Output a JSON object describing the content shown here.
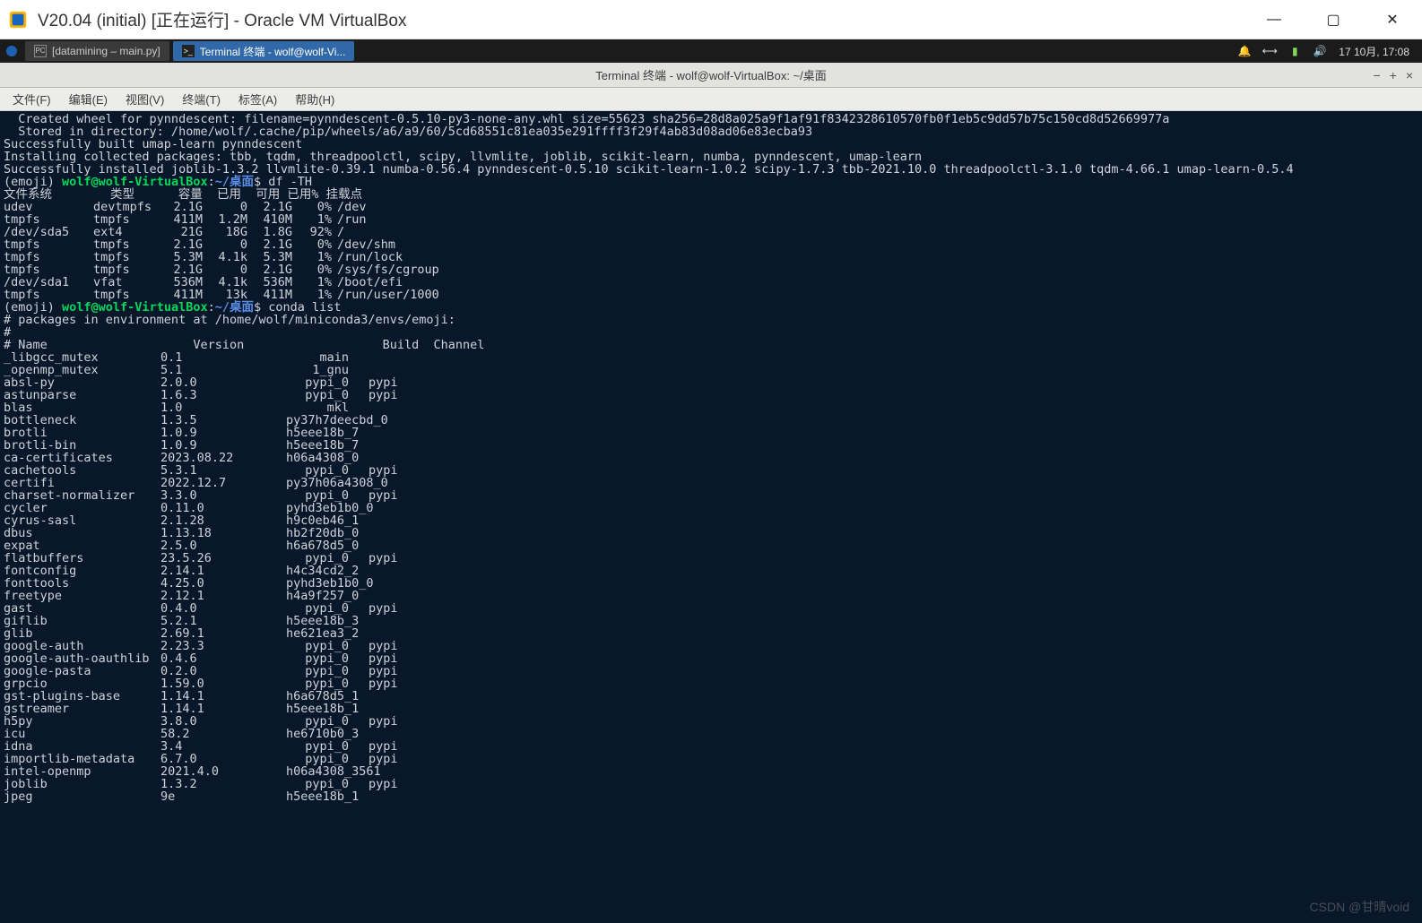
{
  "window": {
    "title": "V20.04 (initial) [正在运行] - Oracle VM VirtualBox",
    "min": "—",
    "max": "▢",
    "close": "✕"
  },
  "panel": {
    "task_inactive": "[datamining – main.py]",
    "task_active": "Terminal 终端 - wolf@wolf-Vi...",
    "clock": "17 10月, 17:08"
  },
  "gterm": {
    "title": "Terminal 终端 - wolf@wolf-VirtualBox: ~/桌面",
    "min": "−",
    "max": "+",
    "close": "×"
  },
  "menubar": {
    "file": "文件(F)",
    "edit": "编辑(E)",
    "view": "视图(V)",
    "terminal": "终端(T)",
    "tabs": "标签(A)",
    "help": "帮助(H)"
  },
  "term": {
    "build_lines": [
      "  Created wheel for pynndescent: filename=pynndescent-0.5.10-py3-none-any.whl size=55623 sha256=28d8a025a9f1af91f8342328610570fb0f1eb5c9dd57b75c150cd8d52669977a",
      "  Stored in directory: /home/wolf/.cache/pip/wheels/a6/a9/60/5cd68551c81ea035e291ffff3f29f4ab83d08ad06e83ecba93",
      "Successfully built umap-learn pynndescent",
      "Installing collected packages: tbb, tqdm, threadpoolctl, scipy, llvmlite, joblib, scikit-learn, numba, pynndescent, umap-learn",
      "Successfully installed joblib-1.3.2 llvmlite-0.39.1 numba-0.56.4 pynndescent-0.5.10 scikit-learn-1.0.2 scipy-1.7.3 tbb-2021.10.0 threadpoolctl-3.1.0 tqdm-4.66.1 umap-learn-0.5.4"
    ],
    "prompt_env": "(emoji) ",
    "prompt_userhost": "wolf@wolf-VirtualBox",
    "prompt_colon": ":",
    "prompt_path": "~/桌面",
    "prompt_dollar": "$ ",
    "cmd_df": "df -TH",
    "cmd_conda": "conda list",
    "df_header": "文件系统        类型      容量  已用  可用 已用% 挂载点",
    "df_rows": [
      {
        "fs": "udev",
        "type": "devtmpfs",
        "size": "2.1G",
        "used": "0",
        "avail": "2.1G",
        "pct": "0%",
        "mnt": "/dev"
      },
      {
        "fs": "tmpfs",
        "type": "tmpfs",
        "size": "411M",
        "used": "1.2M",
        "avail": "410M",
        "pct": "1%",
        "mnt": "/run"
      },
      {
        "fs": "/dev/sda5",
        "type": "ext4",
        "size": "21G",
        "used": "18G",
        "avail": "1.8G",
        "pct": "92%",
        "mnt": "/"
      },
      {
        "fs": "tmpfs",
        "type": "tmpfs",
        "size": "2.1G",
        "used": "0",
        "avail": "2.1G",
        "pct": "0%",
        "mnt": "/dev/shm"
      },
      {
        "fs": "tmpfs",
        "type": "tmpfs",
        "size": "5.3M",
        "used": "4.1k",
        "avail": "5.3M",
        "pct": "1%",
        "mnt": "/run/lock"
      },
      {
        "fs": "tmpfs",
        "type": "tmpfs",
        "size": "2.1G",
        "used": "0",
        "avail": "2.1G",
        "pct": "0%",
        "mnt": "/sys/fs/cgroup"
      },
      {
        "fs": "/dev/sda1",
        "type": "vfat",
        "size": "536M",
        "used": "4.1k",
        "avail": "536M",
        "pct": "1%",
        "mnt": "/boot/efi"
      },
      {
        "fs": "tmpfs",
        "type": "tmpfs",
        "size": "411M",
        "used": "13k",
        "avail": "411M",
        "pct": "1%",
        "mnt": "/run/user/1000"
      }
    ],
    "conda_header1": "# packages in environment at /home/wolf/miniconda3/envs/emoji:",
    "conda_header2": "#",
    "conda_header3": "# Name                    Version                   Build  Channel",
    "packages": [
      {
        "name": "_libgcc_mutex",
        "ver": "0.1",
        "build": "main",
        "ch": ""
      },
      {
        "name": "_openmp_mutex",
        "ver": "5.1",
        "build": "1_gnu",
        "ch": ""
      },
      {
        "name": "absl-py",
        "ver": "2.0.0",
        "build": "pypi_0",
        "ch": "pypi"
      },
      {
        "name": "astunparse",
        "ver": "1.6.3",
        "build": "pypi_0",
        "ch": "pypi"
      },
      {
        "name": "blas",
        "ver": "1.0",
        "build": "mkl",
        "ch": ""
      },
      {
        "name": "bottleneck",
        "ver": "1.3.5",
        "build": "py37h7deecbd_0",
        "ch": ""
      },
      {
        "name": "brotli",
        "ver": "1.0.9",
        "build": "h5eee18b_7",
        "ch": ""
      },
      {
        "name": "brotli-bin",
        "ver": "1.0.9",
        "build": "h5eee18b_7",
        "ch": ""
      },
      {
        "name": "ca-certificates",
        "ver": "2023.08.22",
        "build": "h06a4308_0",
        "ch": ""
      },
      {
        "name": "cachetools",
        "ver": "5.3.1",
        "build": "pypi_0",
        "ch": "pypi"
      },
      {
        "name": "certifi",
        "ver": "2022.12.7",
        "build": "py37h06a4308_0",
        "ch": ""
      },
      {
        "name": "charset-normalizer",
        "ver": "3.3.0",
        "build": "pypi_0",
        "ch": "pypi"
      },
      {
        "name": "cycler",
        "ver": "0.11.0",
        "build": "pyhd3eb1b0_0",
        "ch": ""
      },
      {
        "name": "cyrus-sasl",
        "ver": "2.1.28",
        "build": "h9c0eb46_1",
        "ch": ""
      },
      {
        "name": "dbus",
        "ver": "1.13.18",
        "build": "hb2f20db_0",
        "ch": ""
      },
      {
        "name": "expat",
        "ver": "2.5.0",
        "build": "h6a678d5_0",
        "ch": ""
      },
      {
        "name": "flatbuffers",
        "ver": "23.5.26",
        "build": "pypi_0",
        "ch": "pypi"
      },
      {
        "name": "fontconfig",
        "ver": "2.14.1",
        "build": "h4c34cd2_2",
        "ch": ""
      },
      {
        "name": "fonttools",
        "ver": "4.25.0",
        "build": "pyhd3eb1b0_0",
        "ch": ""
      },
      {
        "name": "freetype",
        "ver": "2.12.1",
        "build": "h4a9f257_0",
        "ch": ""
      },
      {
        "name": "gast",
        "ver": "0.4.0",
        "build": "pypi_0",
        "ch": "pypi"
      },
      {
        "name": "giflib",
        "ver": "5.2.1",
        "build": "h5eee18b_3",
        "ch": ""
      },
      {
        "name": "glib",
        "ver": "2.69.1",
        "build": "he621ea3_2",
        "ch": ""
      },
      {
        "name": "google-auth",
        "ver": "2.23.3",
        "build": "pypi_0",
        "ch": "pypi"
      },
      {
        "name": "google-auth-oauthlib",
        "ver": "0.4.6",
        "build": "pypi_0",
        "ch": "pypi"
      },
      {
        "name": "google-pasta",
        "ver": "0.2.0",
        "build": "pypi_0",
        "ch": "pypi"
      },
      {
        "name": "grpcio",
        "ver": "1.59.0",
        "build": "pypi_0",
        "ch": "pypi"
      },
      {
        "name": "gst-plugins-base",
        "ver": "1.14.1",
        "build": "h6a678d5_1",
        "ch": ""
      },
      {
        "name": "gstreamer",
        "ver": "1.14.1",
        "build": "h5eee18b_1",
        "ch": ""
      },
      {
        "name": "h5py",
        "ver": "3.8.0",
        "build": "pypi_0",
        "ch": "pypi"
      },
      {
        "name": "icu",
        "ver": "58.2",
        "build": "he6710b0_3",
        "ch": ""
      },
      {
        "name": "idna",
        "ver": "3.4",
        "build": "pypi_0",
        "ch": "pypi"
      },
      {
        "name": "importlib-metadata",
        "ver": "6.7.0",
        "build": "pypi_0",
        "ch": "pypi"
      },
      {
        "name": "intel-openmp",
        "ver": "2021.4.0",
        "build": "h06a4308_3561",
        "ch": ""
      },
      {
        "name": "joblib",
        "ver": "1.3.2",
        "build": "pypi_0",
        "ch": "pypi"
      },
      {
        "name": "jpeg",
        "ver": "9e",
        "build": "h5eee18b_1",
        "ch": ""
      }
    ]
  },
  "watermark": "CSDN @甘晴void"
}
